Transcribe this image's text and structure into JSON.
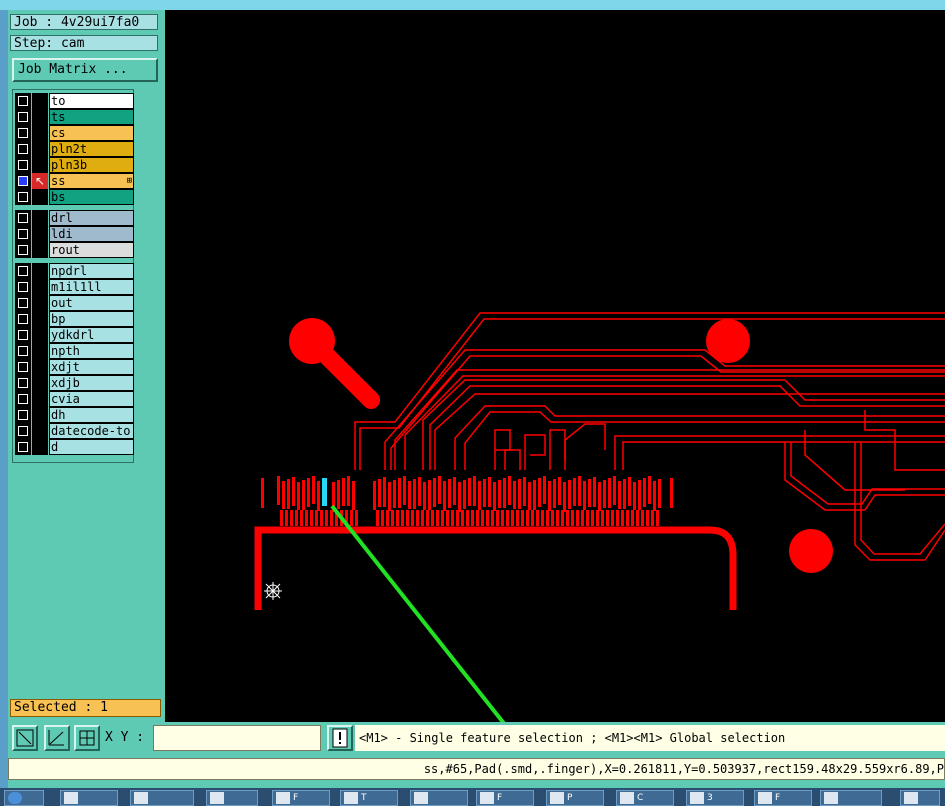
{
  "window": {
    "job_label": "Job : 4v29ui7fa0",
    "step_label": "Step: cam",
    "job_matrix_button": "Job Matrix ..."
  },
  "layers": {
    "group1": [
      {
        "name": "to",
        "color": "#ffffff"
      },
      {
        "name": "ts",
        "color": "#12a181"
      },
      {
        "name": "cs",
        "color": "#f7c154"
      },
      {
        "name": "pln2t",
        "color": "#dfad10"
      },
      {
        "name": "pln3b",
        "color": "#dfad10"
      },
      {
        "name": "ss",
        "color": "#f7c154",
        "selected": true
      },
      {
        "name": "bs",
        "color": "#12a181"
      }
    ],
    "group2": [
      {
        "name": "drl",
        "color": "#9fbacc"
      },
      {
        "name": "ldi",
        "color": "#9fbacc"
      },
      {
        "name": "rout",
        "color": "#dcdcdc"
      }
    ],
    "group3": [
      {
        "name": "npdrl"
      },
      {
        "name": "m1il1ll"
      },
      {
        "name": "out"
      },
      {
        "name": "bp"
      },
      {
        "name": "ydkdrl"
      },
      {
        "name": "npth"
      },
      {
        "name": "xdjt"
      },
      {
        "name": "xdjb"
      },
      {
        "name": "cvia"
      },
      {
        "name": "dh"
      },
      {
        "name": "datecode-to"
      },
      {
        "name": "d"
      }
    ],
    "group3_color": "#a8e1e4"
  },
  "selected_count_text": "Selected : 1",
  "toolbar": {
    "xy_label": "X Y :",
    "xy_value": "",
    "help_text": "<M1> - Single feature selection ; <M1><M1> Global selection"
  },
  "status_text": "ss,#65,Pad(.smd,.finger),X=0.261811,Y=0.503937,rect159.48x29.559xr6.89,P",
  "colors": {
    "panel_bg": "#5fcab4",
    "canvas_bg": "#000000",
    "trace": "#ff0000",
    "highlight": "#27d7f5",
    "arrow": "#22e022"
  },
  "taskbar_items": [
    {
      "label": "",
      "icon": "start-orb-icon"
    },
    {
      "label": "",
      "icon": "document-icon"
    },
    {
      "label": "",
      "icon": "spreadsheet-icon"
    },
    {
      "label": "",
      "icon": "sun-icon"
    },
    {
      "label": "F",
      "icon": "app-icon"
    },
    {
      "label": "T",
      "icon": "save-icon"
    },
    {
      "label": "",
      "icon": "network-icon"
    },
    {
      "label": "F",
      "icon": "window-icon"
    },
    {
      "label": "P",
      "icon": "window-icon"
    },
    {
      "label": "C",
      "icon": "window-icon"
    },
    {
      "label": "3",
      "icon": "word-icon"
    },
    {
      "label": "F",
      "icon": "word-icon"
    },
    {
      "label": "",
      "icon": "folder-icon"
    },
    {
      "label": "",
      "icon": "app-icon"
    }
  ]
}
